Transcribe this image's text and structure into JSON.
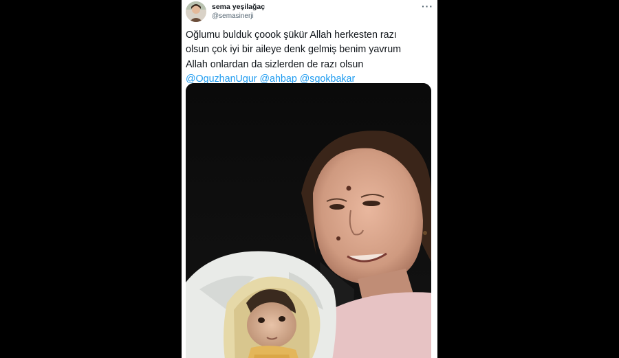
{
  "tweet": {
    "display_name": "sema yeşilağaç",
    "handle": "@semasinerji",
    "more_label": "···",
    "text_lines": [
      "Oğlumu bulduk çoook şükür Allah herkesten razı",
      "olsun çok iyi bir aileye denk gelmiş benim yavrum",
      "Allah onlardan da sizlerden de razı olsun"
    ],
    "mentions": [
      "@OguzhanUgur",
      "@ahbap",
      "@sgokbakar"
    ]
  },
  "colors": {
    "link": "#1d9bf0",
    "text": "#0f1419",
    "secondary": "#536471"
  },
  "icons": {
    "more": "more-horizontal-icon"
  }
}
